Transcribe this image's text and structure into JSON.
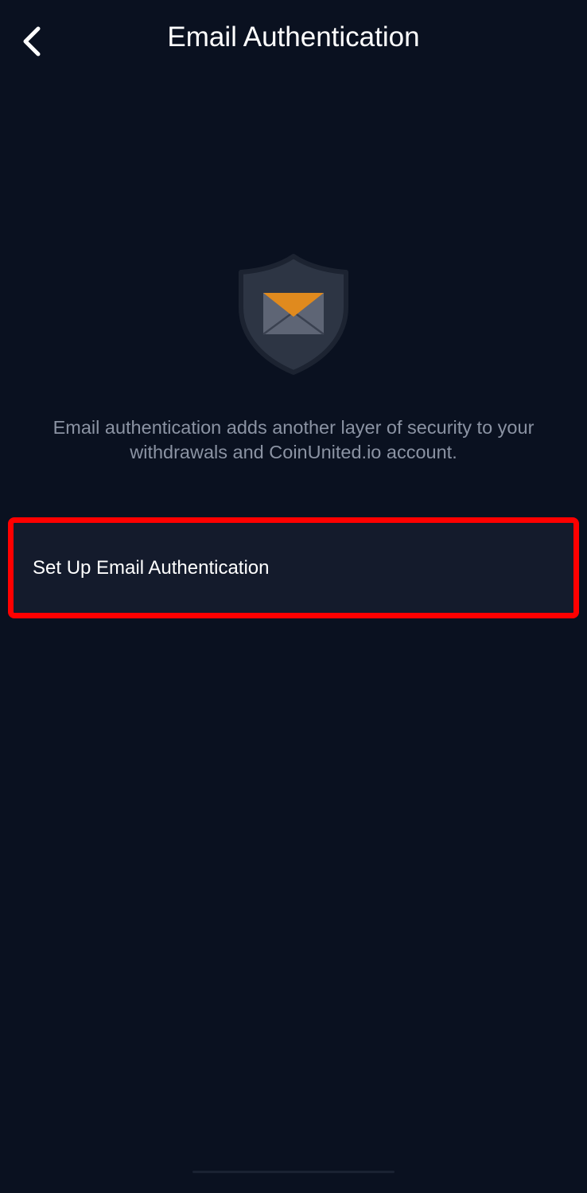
{
  "header": {
    "back_icon": "chevron-left-icon",
    "title": "Email Authentication"
  },
  "hero": {
    "icon": "shield-envelope-icon",
    "shield_color": "#2d3544",
    "shield_border_color": "#1c2331",
    "envelope_color": "#5e6575",
    "envelope_flap_color": "#e08a1e"
  },
  "description": "Email authentication adds another layer of security to your withdrawals and CoinUnited.io account.",
  "setup": {
    "label": "Set Up Email Authentication",
    "highlight_color": "#ff0000"
  },
  "theme": {
    "background": "#0a1120",
    "row_background": "#141b2c",
    "text_primary": "#ffffff",
    "text_secondary": "#8b93a3"
  }
}
